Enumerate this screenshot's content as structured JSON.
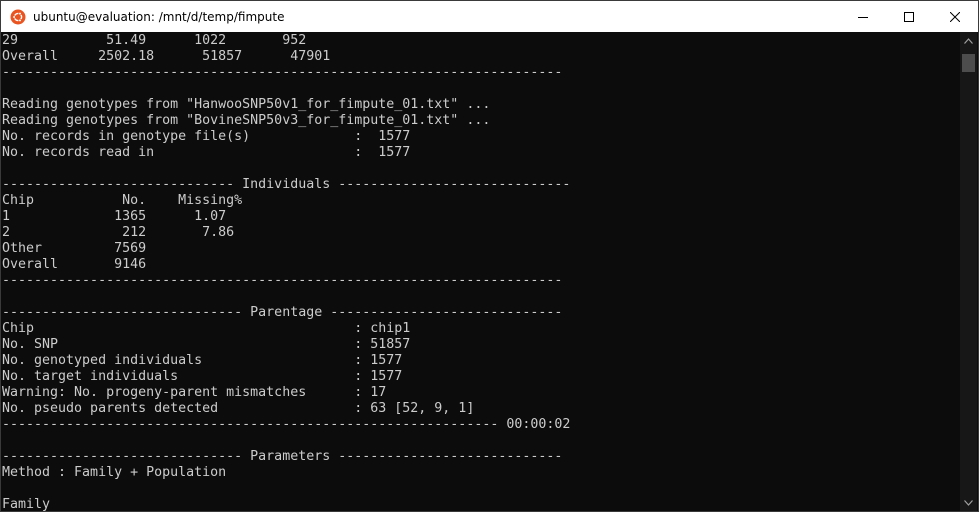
{
  "window": {
    "title": "ubuntu@evaluation: /mnt/d/temp/fimpute",
    "app_icon": "ubuntu-logo-icon",
    "controls": [
      "minimize-icon",
      "maximize-icon",
      "close-icon"
    ]
  },
  "colors": {
    "terminal_bg": "#0c0c0c",
    "terminal_fg": "#cccccc",
    "titlebar_bg": "#ffffff",
    "ubuntu_orange": "#e95420"
  },
  "terminal": {
    "lines": [
      "29           51.49      1022       952",
      "Overall     2502.18      51857      47901",
      "----------------------------------------------------------------------",
      "",
      "Reading genotypes from \"HanwooSNP50v1_for_fimpute_01.txt\" ...",
      "Reading genotypes from \"BovineSNP50v3_for_fimpute_01.txt\" ...",
      "No. records in genotype file(s)             :  1577",
      "No. records read in                         :  1577",
      "",
      "----------------------------- Individuals -----------------------------",
      "Chip           No.    Missing%",
      "1             1365      1.07",
      "2              212       7.86",
      "Other         7569",
      "Overall       9146",
      "----------------------------------------------------------------------",
      "",
      "------------------------------ Parentage -----------------------------",
      "Chip                                        : chip1",
      "No. SNP                                     : 51857",
      "No. genotyped individuals                   : 1577",
      "No. target individuals                      : 1577",
      "Warning: No. progeny-parent mismatches      : 17",
      "No. pseudo parents detected                 : 63 [52, 9, 1]",
      "-------------------------------------------------------------- 00:00:02",
      "",
      "------------------------------ Parameters ----------------------------",
      "Method : Family + Population",
      "",
      "Family"
    ]
  },
  "scrollbar": {
    "up_icon": "scroll-up-arrow-icon",
    "down_icon": "scroll-down-arrow-icon",
    "position_fraction": 0.05
  }
}
